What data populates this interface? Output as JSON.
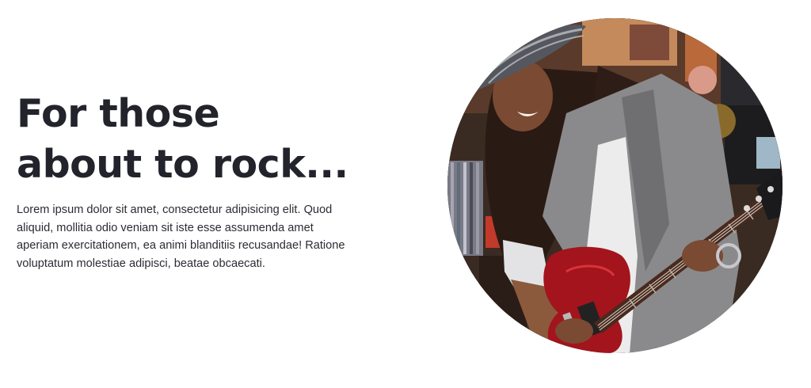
{
  "hero": {
    "headline": "For those about to rock...",
    "body": "Lorem ipsum dolor sit amet, consectetur adipisicing elit. Quod aliquid, mollitia odio veniam sit iste esse assumenda amet aperiam exercitationem, ea animi blanditiis recusandae! Ratione voluptatum molestiae adipisci, beatae obcaecati."
  },
  "colors": {
    "background": "#ffffff",
    "heading": "#22232b",
    "text": "#2b2c34",
    "guitar": "#a3141c",
    "jacket": "#8a8a8c"
  }
}
